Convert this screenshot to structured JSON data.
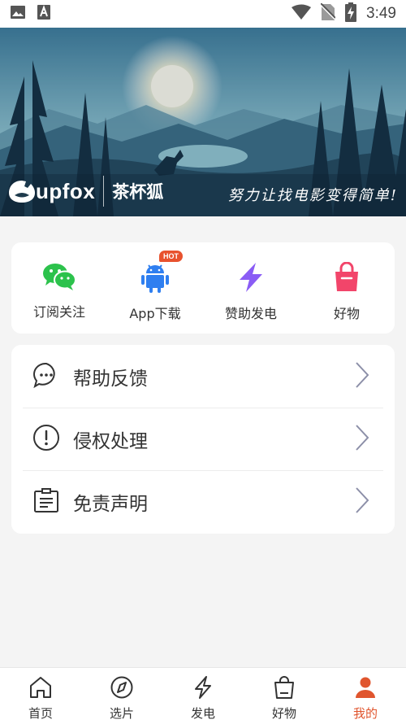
{
  "status_bar": {
    "time": "3:49",
    "icons": [
      "image-icon",
      "text-a-icon",
      "wifi-icon",
      "no-sim-icon",
      "battery-charging-icon"
    ]
  },
  "banner": {
    "logo_text": "upfox",
    "brand_cn": "茶杯狐",
    "slogan": "努力让找电影变得简单!"
  },
  "quick_actions": [
    {
      "label": "订阅关注",
      "icon": "wechat-icon",
      "color": "#2cc24c"
    },
    {
      "label": "App下载",
      "icon": "android-icon",
      "color": "#2f7ff0",
      "badge": "HOT"
    },
    {
      "label": "赞助发电",
      "icon": "lightning-icon",
      "color": "#8a5cf5"
    },
    {
      "label": "好物",
      "icon": "shopping-bag-icon",
      "color": "#f2456a"
    }
  ],
  "menu": [
    {
      "label": "帮助反馈",
      "icon": "chat-bubble-icon"
    },
    {
      "label": "侵权处理",
      "icon": "alert-circle-icon"
    },
    {
      "label": "免责声明",
      "icon": "document-icon"
    }
  ],
  "tabbar": {
    "active_color": "#e0552e",
    "tabs": [
      {
        "label": "首页",
        "icon": "home-icon"
      },
      {
        "label": "选片",
        "icon": "compass-icon"
      },
      {
        "label": "发电",
        "icon": "lightning-icon"
      },
      {
        "label": "好物",
        "icon": "shopping-bag-icon"
      },
      {
        "label": "我的",
        "icon": "user-icon",
        "active": true
      }
    ]
  }
}
